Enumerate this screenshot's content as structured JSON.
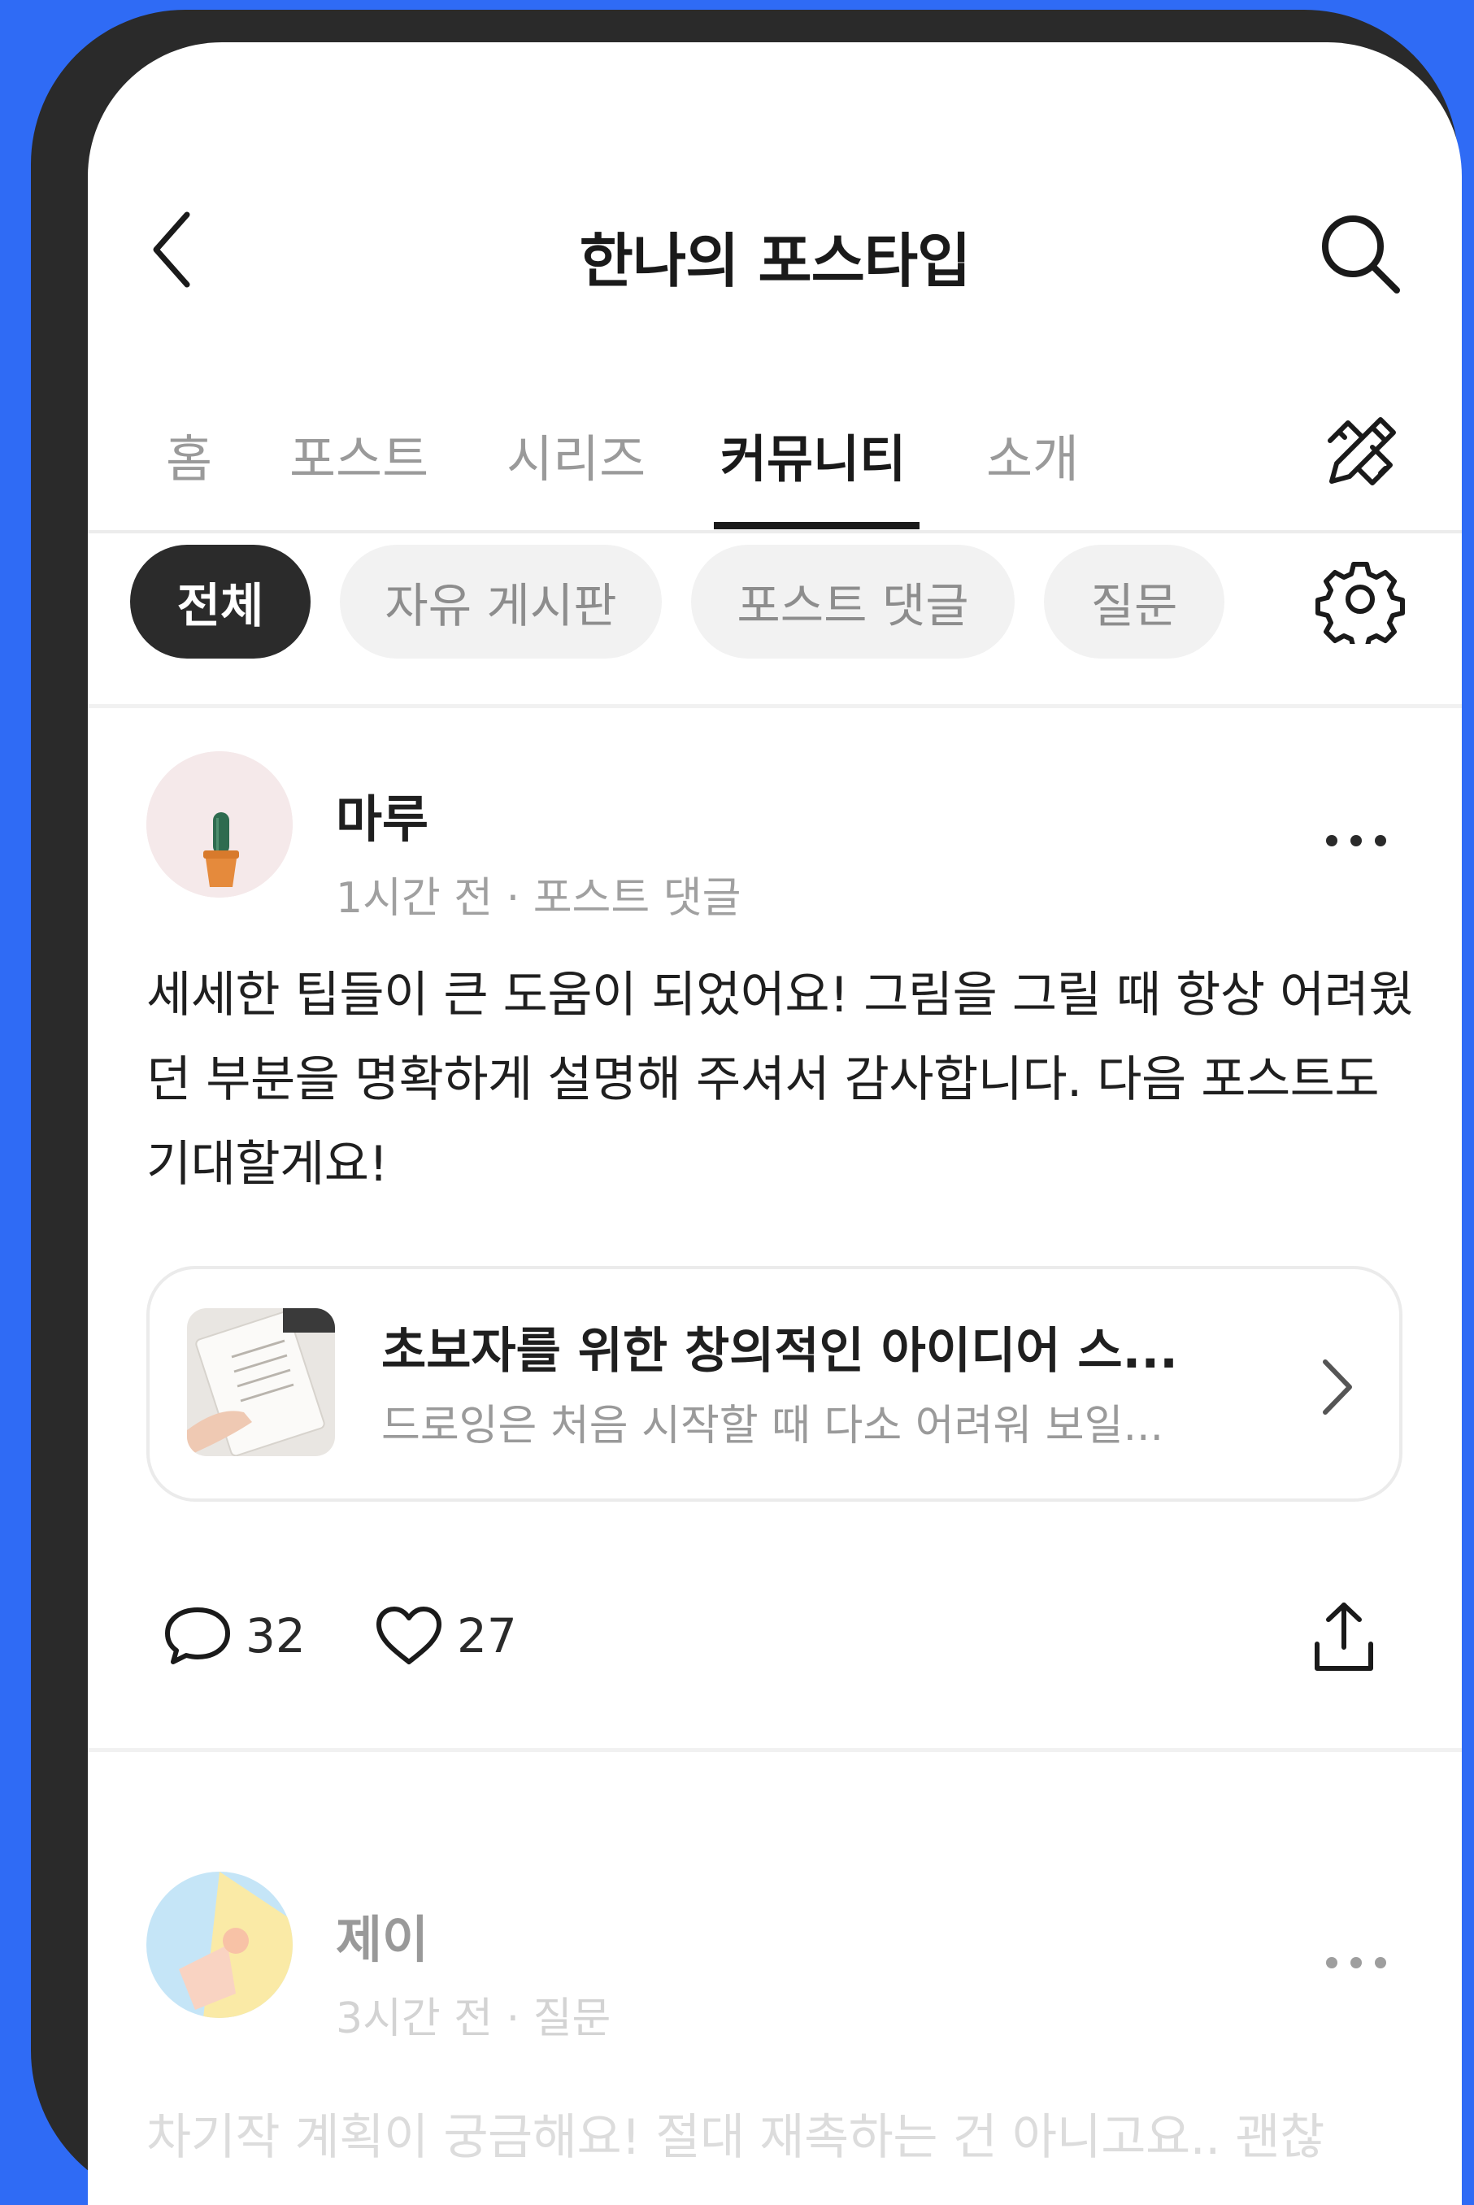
{
  "header": {
    "title": "한나의 포스타입",
    "back_icon": "chevron-left-icon",
    "search_icon": "search-icon"
  },
  "tabs": [
    {
      "label": "홈",
      "active": false
    },
    {
      "label": "포스트",
      "active": false
    },
    {
      "label": "시리즈",
      "active": false
    },
    {
      "label": "커뮤니티",
      "active": true
    },
    {
      "label": "소개",
      "active": false
    }
  ],
  "write_icon": "pencil-ruler-icon",
  "filters": [
    {
      "label": "전체",
      "active": true
    },
    {
      "label": "자유 게시판",
      "active": false
    },
    {
      "label": "포스트 댓글",
      "active": false
    },
    {
      "label": "질문",
      "active": false
    }
  ],
  "settings_icon": "gear-icon",
  "posts": [
    {
      "author": "마루",
      "meta": "1시간 전 · 포스트 댓글",
      "body": "세세한 팁들이 큰 도움이 되었어요! 그림을 그릴 때 항상 어려웠던 부분을 명확하게 설명해 주셔서 감사합니다. 다음 포스트도 기대할게요!",
      "linked_post": {
        "title": "초보자를 위한 창의적인 아이디어 스...",
        "excerpt": "드로잉은 처음 시작할 때 다소 어려워 보일..."
      },
      "comments": "32",
      "likes": "27"
    },
    {
      "author": "제이",
      "meta": "3시간 전 · 질문",
      "body": "차기작 계획이 궁금해요! 절대 재촉하는 건 아니고요.. 괜찮"
    }
  ],
  "colors": {
    "background": "#2f6bf5",
    "frame": "#2a2a2a",
    "active_chip": "#2b2b2b",
    "chip": "#f2f2f2"
  }
}
